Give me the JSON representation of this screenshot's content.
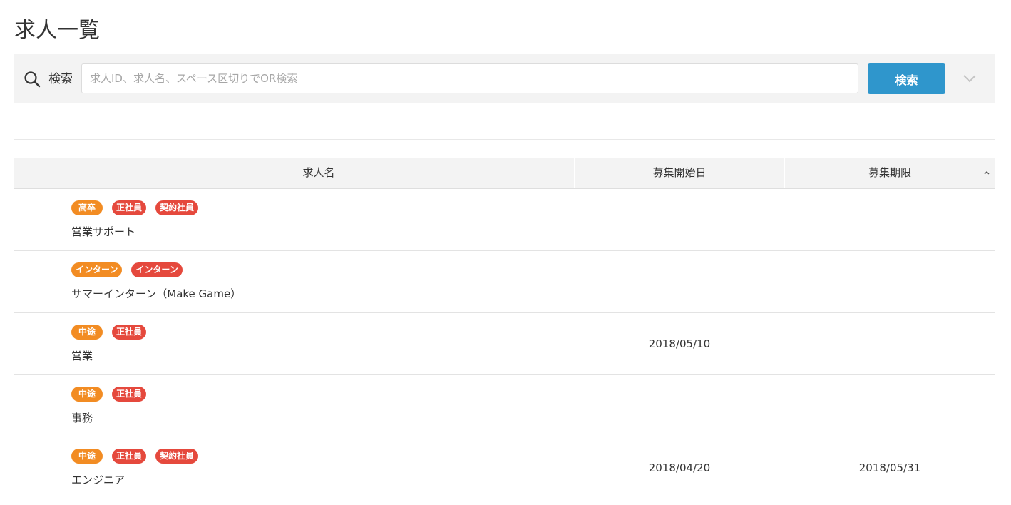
{
  "page": {
    "title": "求人一覧"
  },
  "search": {
    "label": "検索",
    "placeholder": "求人ID、求人名、スペース区切りでOR検索",
    "value": "",
    "button_label": "検索",
    "icon": "search-icon",
    "toggle_icon": "chevron-down-icon"
  },
  "table": {
    "headers": {
      "name": "求人名",
      "start_date": "募集開始日",
      "deadline": "募集期限"
    },
    "sort_icon": "caret-up-icon",
    "rows": [
      {
        "tags": [
          {
            "label": "高卒",
            "color": "orange"
          },
          {
            "label": "正社員",
            "color": "red"
          },
          {
            "label": "契約社員",
            "color": "red"
          }
        ],
        "name": "営業サポート",
        "start_date": "",
        "deadline": ""
      },
      {
        "tags": [
          {
            "label": "インターン",
            "color": "orange"
          },
          {
            "label": "インターン",
            "color": "red"
          }
        ],
        "name": "サマーインターン（Make Game）",
        "start_date": "",
        "deadline": ""
      },
      {
        "tags": [
          {
            "label": "中途",
            "color": "orange"
          },
          {
            "label": "正社員",
            "color": "red"
          }
        ],
        "name": "営業",
        "start_date": "2018/05/10",
        "deadline": ""
      },
      {
        "tags": [
          {
            "label": "中途",
            "color": "orange"
          },
          {
            "label": "正社員",
            "color": "red"
          }
        ],
        "name": "事務",
        "start_date": "",
        "deadline": ""
      },
      {
        "tags": [
          {
            "label": "中途",
            "color": "orange"
          },
          {
            "label": "正社員",
            "color": "red"
          },
          {
            "label": "契約社員",
            "color": "red"
          }
        ],
        "name": "エンジニア",
        "start_date": "2018/04/20",
        "deadline": "2018/05/31"
      }
    ]
  },
  "colors": {
    "accent": "#2f96cc",
    "tag_orange": "#f28c23",
    "tag_red": "#e5493d",
    "bar_bg": "#f3f3f3"
  }
}
